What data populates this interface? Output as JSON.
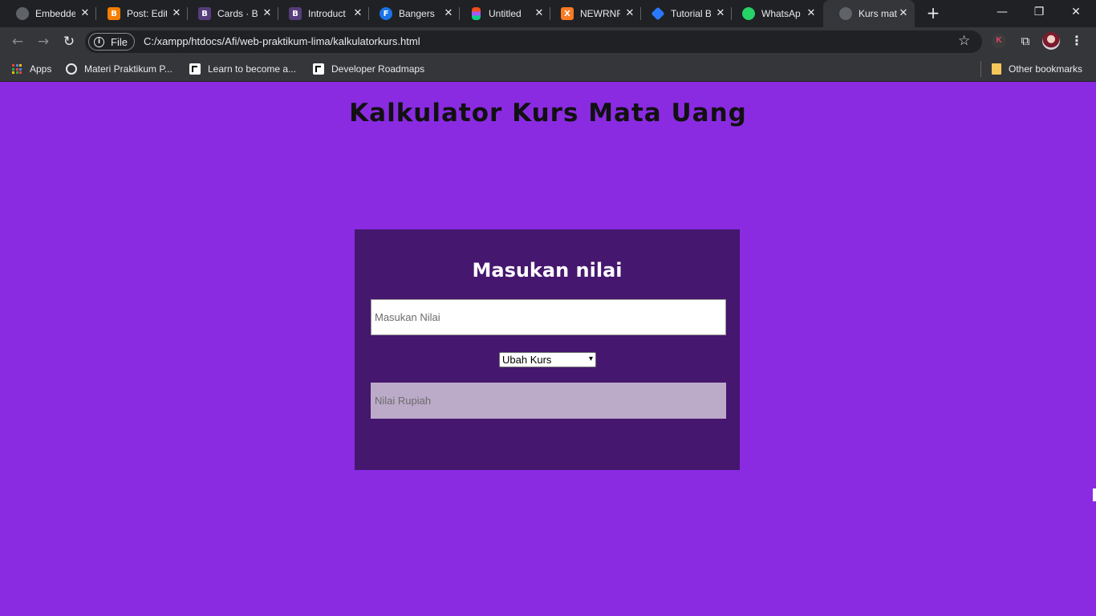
{
  "browser": {
    "tabs": [
      {
        "label": "Embedde",
        "icon": "globe-icon",
        "color": "#5f6368",
        "glyph": ""
      },
      {
        "label": "Post: Edit",
        "icon": "blogger-icon",
        "color": "#f57d00",
        "glyph": "B"
      },
      {
        "label": "Cards · B",
        "icon": "bootstrap-icon",
        "color": "#563d7c",
        "glyph": "B"
      },
      {
        "label": "Introduct",
        "icon": "bootstrap-icon",
        "color": "#563d7c",
        "glyph": "B"
      },
      {
        "label": "Bangers",
        "icon": "fonts-icon",
        "color": "#1a73e8",
        "glyph": "F"
      },
      {
        "label": "Untitled",
        "icon": "figma-icon",
        "color": "#f24e1e",
        "glyph": ""
      },
      {
        "label": "NEWRNF",
        "icon": "xampp-icon",
        "color": "#fb7a24",
        "glyph": "X"
      },
      {
        "label": "Tutorial B",
        "icon": "code-icon",
        "color": "#2979ff",
        "glyph": "<>"
      },
      {
        "label": "WhatsAp",
        "icon": "whatsapp-icon",
        "color": "#25d366",
        "glyph": ""
      },
      {
        "label": "Kurs mat",
        "icon": "globe-icon",
        "color": "#5f6368",
        "glyph": ""
      }
    ],
    "active_tab_index": 9,
    "new_tab_symbol": "+",
    "window_controls": {
      "minimize": "—",
      "restore": "❐",
      "close": "✕"
    },
    "nav": {
      "back": "←",
      "forward": "→",
      "reload": "↻"
    },
    "omnibox": {
      "security_chip": "File",
      "url": "C:/xampp/htdocs/Afi/web-praktikum-lima/kalkulatorkurs.html"
    },
    "toolbar_icons": {
      "star": "☆",
      "extension_k": "K",
      "puzzle": "⧉",
      "menu": "⋮"
    },
    "bookmarks": [
      {
        "label": "Apps",
        "icon": "apps-icon"
      },
      {
        "label": "Materi Praktikum P...",
        "icon": "globe-icon"
      },
      {
        "label": "Learn to become a...",
        "icon": "roadmap-icon"
      },
      {
        "label": "Developer Roadmaps",
        "icon": "roadmap-icon"
      }
    ],
    "other_bookmarks": "Other bookmarks"
  },
  "page": {
    "heading": "Kalkulator Kurs Mata Uang",
    "card": {
      "title": "Masukan nilai",
      "input": {
        "placeholder": "Masukan Nilai",
        "value": ""
      },
      "select": {
        "selected": "Ubah Kurs"
      },
      "output": {
        "placeholder": "Nilai Rupiah",
        "value": ""
      }
    }
  },
  "colors": {
    "page_bg": "#8a2be2",
    "card_bg": "#45176e",
    "output_bg": "#bcaac9"
  }
}
